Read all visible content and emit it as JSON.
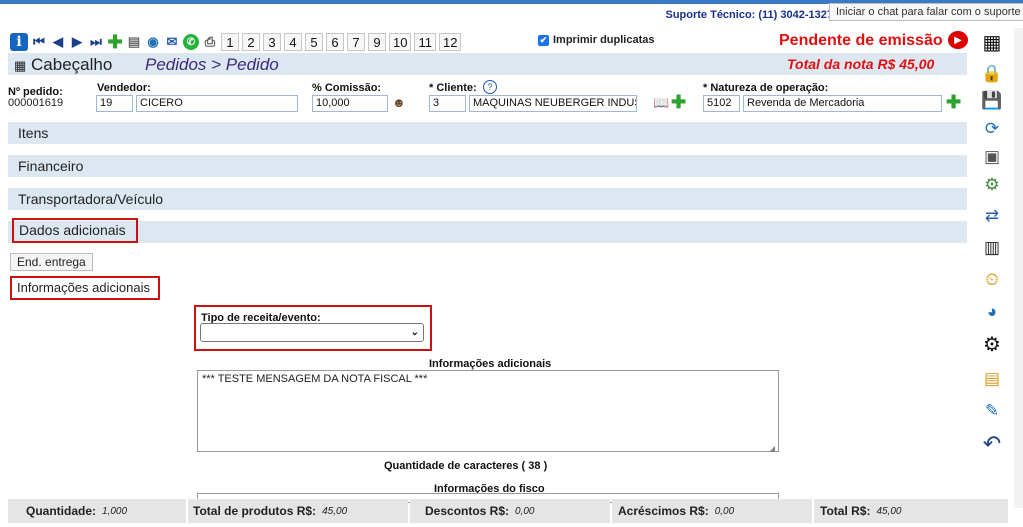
{
  "support": {
    "text": "Suporte Técnico: (11) 3042-1327",
    "chat_tooltip": "Iniciar o chat para falar com o suporte"
  },
  "toolbar": {
    "numbers": [
      "1",
      "2",
      "3",
      "4",
      "5",
      "6",
      "7",
      "9",
      "10",
      "11",
      "12"
    ],
    "print_duplicates_label": "Imprimir duplicatas",
    "print_duplicates_checked": true
  },
  "status": "Pendente de emissão",
  "header": {
    "title": "Cabeçalho",
    "breadcrumb": "Pedidos > Pedido",
    "total": "Total da nota R$ 45,00"
  },
  "form": {
    "order_number_label": "Nº pedido:",
    "order_number": "000001619",
    "seller_label": "Vendedor:",
    "seller_code": "19",
    "seller_name": "CICERO",
    "commission_label": "% Comissão:",
    "commission_value": "10,000",
    "client_label": "* Cliente:",
    "client_code": "3",
    "client_name": "MAQUINAS NEUBERGER INDUSTRIA",
    "nature_label": "* Natureza de operação:",
    "nature_code": "5102",
    "nature_name": "Revenda de Mercadoria"
  },
  "sections": {
    "items": "Itens",
    "financial": "Financeiro",
    "carrier": "Transportadora/Veículo",
    "additional": "Dados adicionais"
  },
  "subtabs": {
    "delivery": "End. entrega",
    "additional_info": "Informações adicionais"
  },
  "revenue_type": {
    "label": "Tipo de receita/evento:",
    "value": ""
  },
  "additional_info": {
    "title": "Informações adicionais",
    "text": "*** TESTE MENSAGEM DA NOTA FISCAL ***",
    "char_count": "Quantidade de caracteres ( 38 )",
    "fiscal_title": "Informações do fisco"
  },
  "footer": {
    "quantity_label": "Quantidade:",
    "quantity_value": "1,000",
    "products_label": "Total de produtos R$:",
    "products_value": "45,00",
    "discounts_label": "Descontos R$:",
    "discounts_value": "0,00",
    "additions_label": "Acréscimos R$:",
    "additions_value": "0,00",
    "total_label": "Total R$:",
    "total_value": "45,00"
  },
  "colors": {
    "accent": "#1a2f8c",
    "status_red": "#e01010",
    "section_bg": "#dde7f2",
    "highlight_border": "#cc1111"
  }
}
